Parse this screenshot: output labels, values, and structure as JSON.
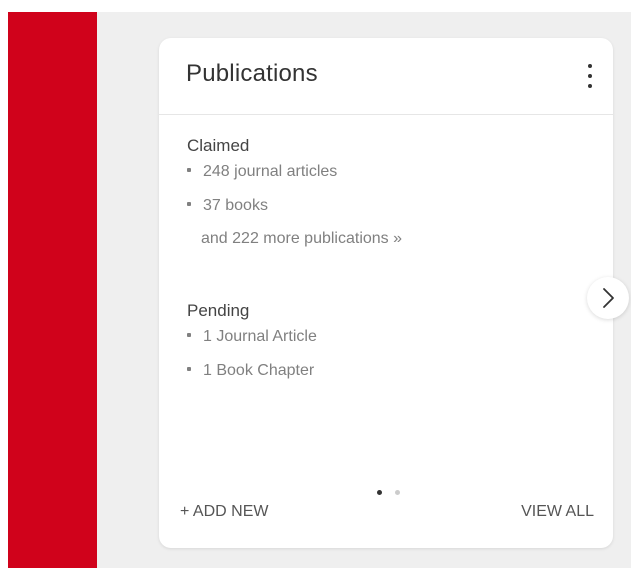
{
  "card": {
    "title": "Publications",
    "claimed": {
      "heading": "Claimed",
      "items": [
        "248 journal articles",
        "37 books"
      ],
      "more_link": "and 222 more publications »"
    },
    "pending": {
      "heading": "Pending",
      "items": [
        "1 Journal Article",
        "1 Book Chapter"
      ]
    },
    "footer": {
      "add_new": "+ ADD NEW",
      "view_all": "VIEW ALL"
    },
    "pagination": {
      "pages": 2,
      "active_page": 1
    }
  },
  "icons": {
    "menu": "more-vertical-icon",
    "next": "chevron-right-icon"
  },
  "colors": {
    "brand_red": "#d0021b",
    "background": "#efefef",
    "card": "#ffffff",
    "active_dot": "#333333",
    "inactive_dot": "#cccccc"
  }
}
